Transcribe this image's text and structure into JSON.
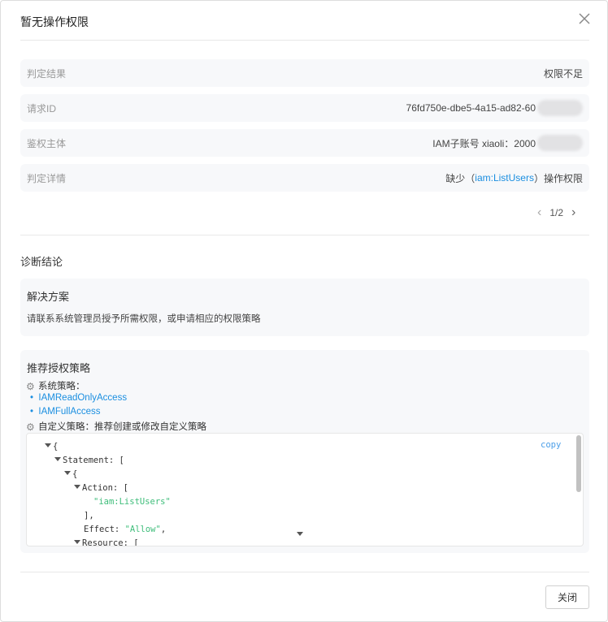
{
  "dialog": {
    "title": "暂无操作权限",
    "close_label": "关闭"
  },
  "rows": [
    {
      "key": "判定结果",
      "value": "权限不足"
    },
    {
      "key": "请求ID",
      "value": "76fd750e-dbe5-4a15-ad82-60"
    },
    {
      "key": "鉴权主体",
      "value": "IAM子账号 xiaoli：2000"
    },
    {
      "key": "判定详情",
      "prefix": "缺少（",
      "link": "iam:ListUsers",
      "suffix": "）操作权限"
    }
  ],
  "pager": {
    "text": "1/2"
  },
  "diagnosis": {
    "title": "诊断结论",
    "solution": {
      "title": "解决方案",
      "text": "请联系系统管理员授予所需权限，或申请相应的权限策略"
    },
    "recommend": {
      "title": "推荐授权策略",
      "system_label": "系统策略：",
      "system_policies": [
        "IAMReadOnlyAccess",
        "IAMFullAccess"
      ],
      "custom_label": "自定义策略：推荐创建或修改自定义策略",
      "copy_label": "copy",
      "code": {
        "l1": "{",
        "l2": "Statement: [",
        "l3": "{",
        "l4": "Action: [",
        "l5": "\"iam:ListUsers\"",
        "l6": "],",
        "l7k": "Effect: ",
        "l7v": "\"Allow\"",
        "l7e": ",",
        "l8": "Resource: ["
      }
    }
  },
  "colors": {
    "link": "#1a8ee0",
    "string": "#3ebd7a",
    "panel": "#f7f8fa"
  }
}
